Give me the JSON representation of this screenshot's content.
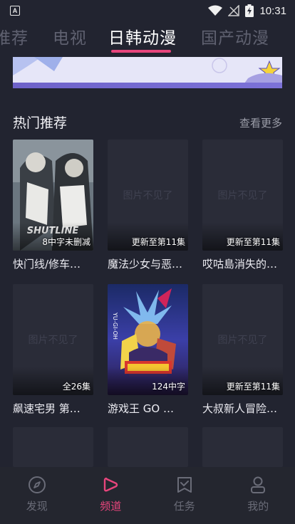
{
  "status_bar": {
    "time": "10:31",
    "left_icon": "a-notification-icon",
    "icons": [
      "wifi-icon",
      "no-signal-icon",
      "battery-charging-icon"
    ]
  },
  "tabs": [
    {
      "label": "推荐",
      "active": false
    },
    {
      "label": "电视",
      "active": false
    },
    {
      "label": "日韩动漫",
      "active": true
    },
    {
      "label": "国产动漫",
      "active": false
    }
  ],
  "section": {
    "title": "热门推荐",
    "more": "查看更多"
  },
  "cards": [
    {
      "title": "快门线/修车…",
      "tag": "8中字未删减",
      "placeholder": "",
      "poster": "shutline"
    },
    {
      "title": "魔法少女与恶…",
      "tag": "更新至第11集",
      "placeholder": "图片不见了",
      "poster": ""
    },
    {
      "title": "哎咕島消失的…",
      "tag": "更新至第11集",
      "placeholder": "图片不见了",
      "poster": ""
    },
    {
      "title": "飙速宅男 第…",
      "tag": "全26集",
      "placeholder": "图片不见了",
      "poster": ""
    },
    {
      "title": "游戏王 GO …",
      "tag": "124中字",
      "placeholder": "",
      "poster": "yugioh"
    },
    {
      "title": "大叔新人冒险…",
      "tag": "更新至第11集",
      "placeholder": "图片不见了",
      "poster": ""
    }
  ],
  "bottom_nav": [
    {
      "label": "发现",
      "icon": "compass-icon",
      "active": false
    },
    {
      "label": "频道",
      "icon": "play-icon",
      "active": true
    },
    {
      "label": "任务",
      "icon": "task-check-icon",
      "active": false
    },
    {
      "label": "我的",
      "icon": "user-icon",
      "active": false
    }
  ],
  "colors": {
    "background": "#222430",
    "accent": "#e7457c",
    "card": "#2a2c38",
    "muted": "#6a6c78"
  }
}
